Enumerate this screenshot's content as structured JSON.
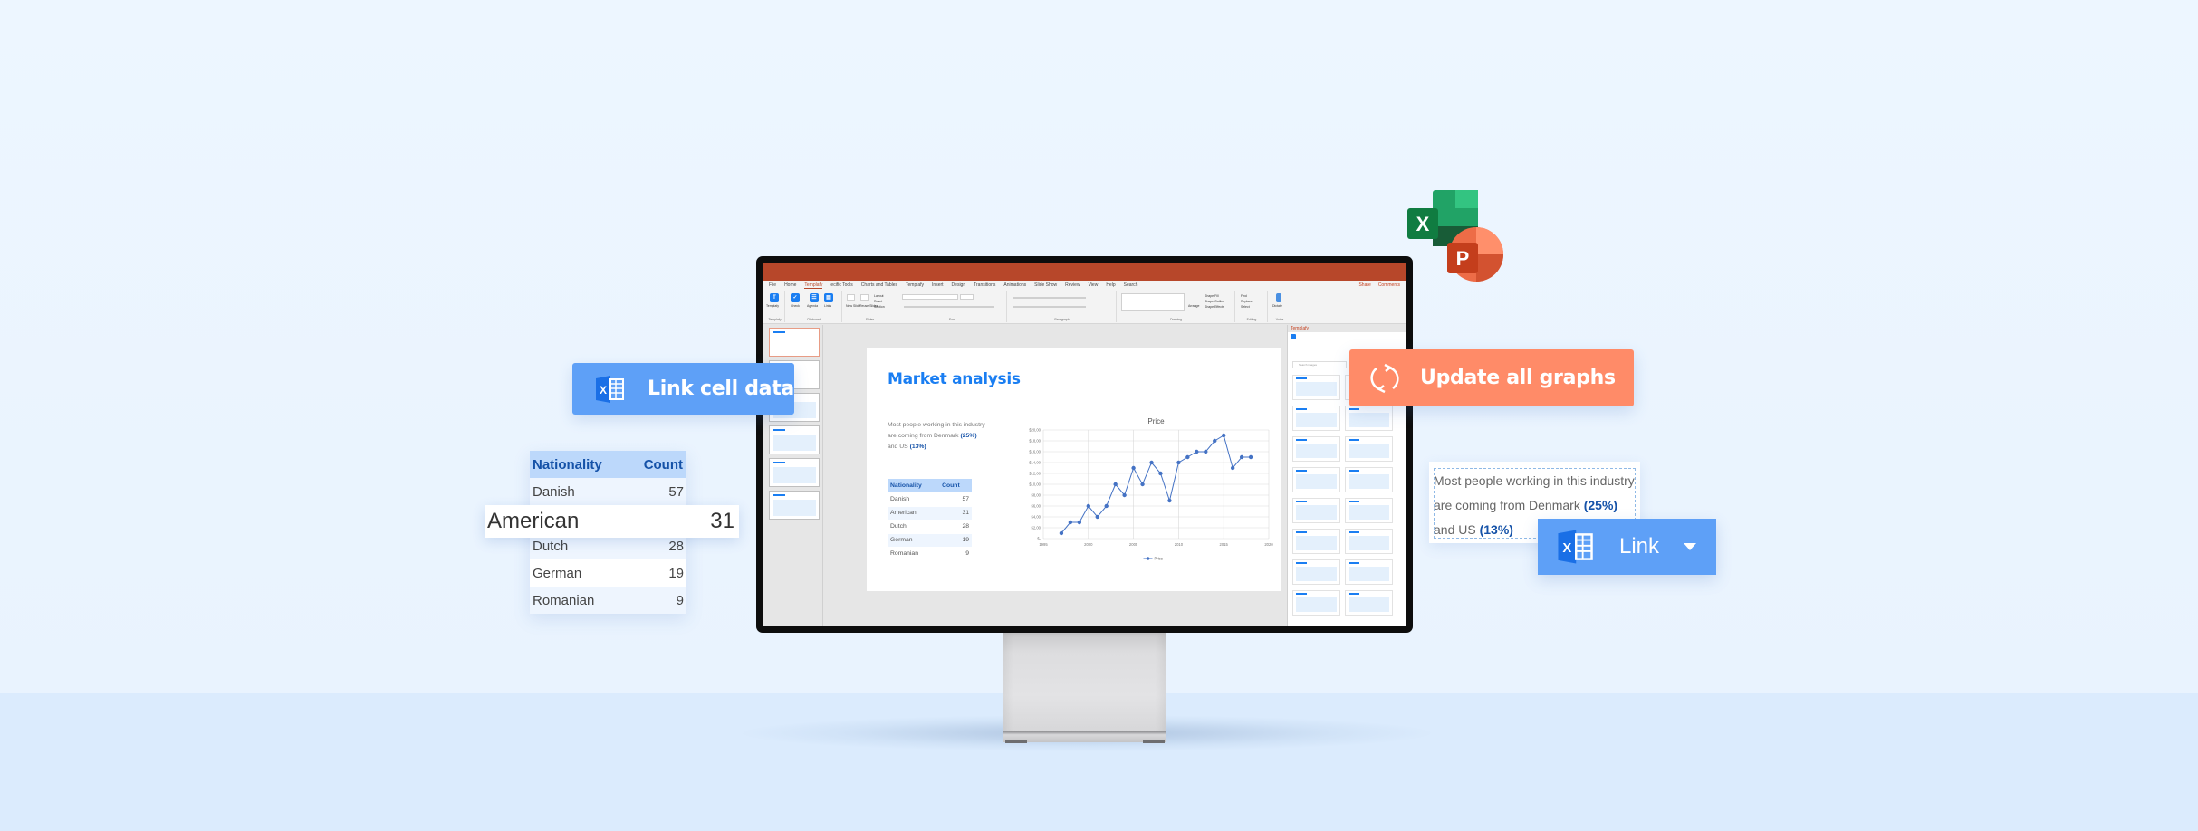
{
  "powerpoint": {
    "ribbon_tabs": [
      "File",
      "Home",
      "Templafy",
      "ecific Tools",
      "Charts and Tables",
      "Templafy",
      "Insert",
      "Design",
      "Transitions",
      "Animations",
      "Slide Show",
      "Review",
      "View",
      "Help",
      "Search"
    ],
    "active_tab": "Templafy",
    "share_label": "Share",
    "comments_label": "Comments",
    "ribbon_buttons": {
      "templafy": "Templafy",
      "check": "Check",
      "agenda": "Agenda",
      "links": "Links",
      "new_slide": "New Slide",
      "reuse_slides": "Reuse Slides",
      "layout": "Layout",
      "reset": "Reset",
      "section": "Section",
      "arrange": "Arrange",
      "quick_styles": "Quick Styles",
      "shape_fill": "Shape Fill",
      "shape_outline": "Shape Outline",
      "shape_effects": "Shape Effects",
      "find": "Find",
      "replace": "Replace",
      "select": "Select",
      "dictate": "Dictate"
    },
    "ribbon_groups": [
      "Templafy",
      "Clipboard",
      "Slides",
      "Font",
      "Paragraph",
      "Drawing",
      "Editing",
      "Voice"
    ],
    "pane_title": "Templafy",
    "pane_search_placeholder": "Search images",
    "slide": {
      "title": "Market analysis",
      "text_line1": "Most people working in this industry",
      "text_line2": "are coming from Denmark ",
      "text_pct1": "(25%)",
      "text_line3": "and US ",
      "text_pct2": "(13%)",
      "table": {
        "headers": [
          "Nationality",
          "Count"
        ],
        "rows": [
          [
            "Danish",
            "57"
          ],
          [
            "American",
            "31"
          ],
          [
            "Dutch",
            "28"
          ],
          [
            "German",
            "19"
          ],
          [
            "Romanian",
            "9"
          ]
        ]
      }
    }
  },
  "overlays": {
    "link_cell_data_label": "Link cell data",
    "update_all_graphs_label": "Update all graphs",
    "link_label": "Link",
    "highlight_row": [
      "American",
      "31"
    ],
    "textbox": {
      "line1": "Most people working in this industry",
      "line2": "are coming from Denmark ",
      "pct1": "(25%)",
      "line3": "and US ",
      "pct2": "(13%)"
    },
    "table": {
      "headers": [
        "Nationality",
        "Count"
      ],
      "rows": [
        [
          "Danish",
          "57"
        ],
        [
          "American",
          "31"
        ],
        [
          "Dutch",
          "28"
        ],
        [
          "German",
          "19"
        ],
        [
          "Romanian",
          "9"
        ]
      ]
    }
  },
  "colors": {
    "powerpoint_red": "#b7472a",
    "link_blue": "#5ea0f7",
    "update_orange": "#ff8b68",
    "title_blue": "#1a7ef2",
    "chart_blue": "#4472c4"
  },
  "chart_data": {
    "type": "line",
    "title": "Price",
    "xlabel": "",
    "ylabel": "",
    "x": [
      1997,
      1998,
      1999,
      2000,
      2001,
      2002,
      2003,
      2004,
      2005,
      2006,
      2007,
      2008,
      2009,
      2010,
      2011,
      2012,
      2013,
      2014,
      2015,
      2016,
      2017,
      2018
    ],
    "series": [
      {
        "name": "Price",
        "values": [
          1,
          3,
          3,
          6,
          4,
          6,
          10,
          8,
          13,
          10,
          14,
          12,
          7,
          14,
          15,
          16,
          16,
          18,
          19,
          13,
          15,
          15
        ]
      }
    ],
    "xlim": [
      1995,
      2020
    ],
    "ylim": [
      0,
      20
    ],
    "x_ticks": [
      "1995",
      "2000",
      "2005",
      "2010",
      "2015",
      "2020"
    ],
    "y_ticks": [
      "$-",
      "$2,00",
      "$4,00",
      "$6,00",
      "$8,00",
      "$10,00",
      "$12,00",
      "$14,00",
      "$16,00",
      "$18,00",
      "$20,00"
    ],
    "grid": true,
    "legend": "bottom"
  }
}
